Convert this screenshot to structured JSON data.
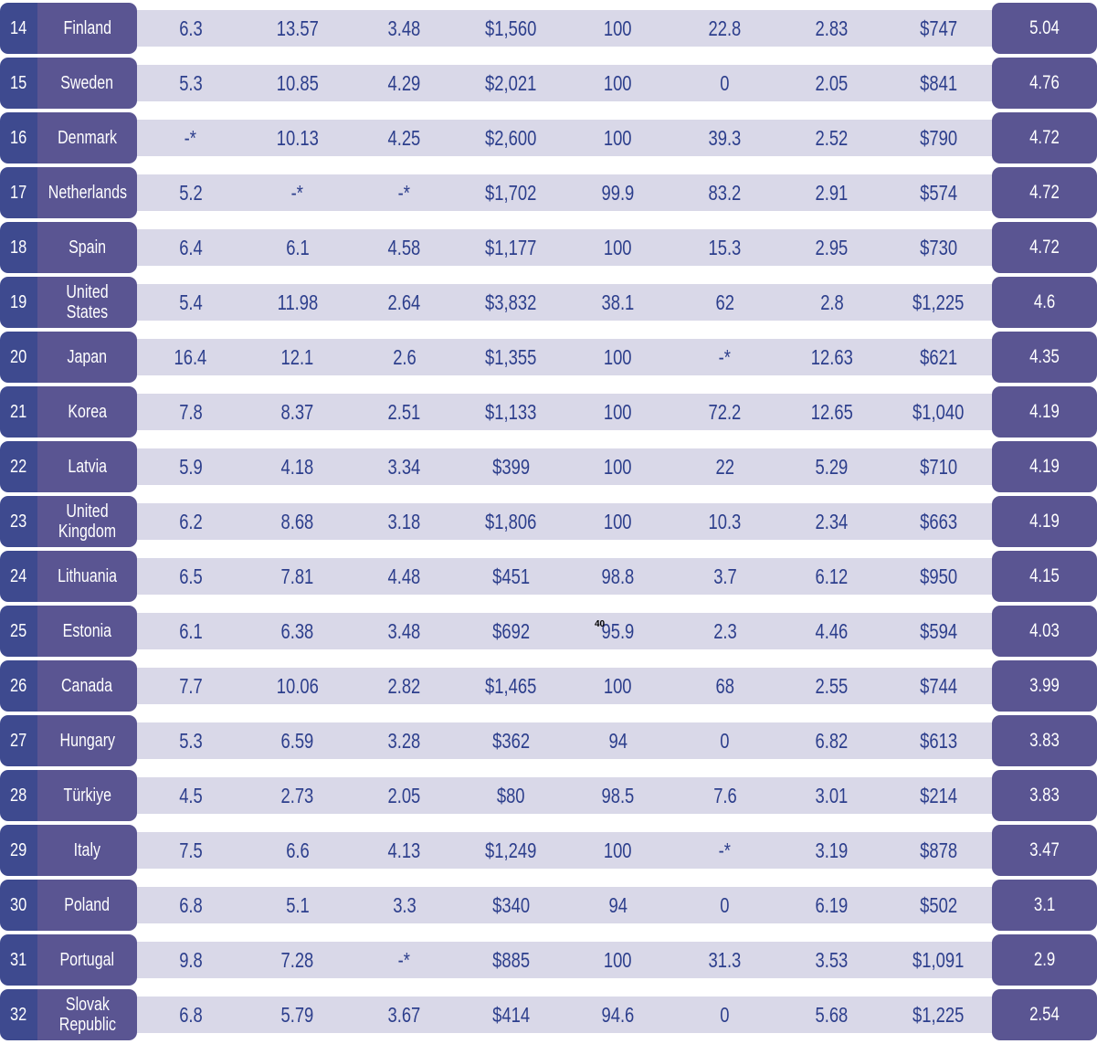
{
  "table": {
    "rows": [
      {
        "rank": "14",
        "country": "Finland",
        "values": [
          "6.3",
          "13.57",
          "3.48",
          "$1,560",
          "100",
          "22.8",
          "2.83",
          "$747"
        ],
        "score": "5.04"
      },
      {
        "rank": "15",
        "country": "Sweden",
        "values": [
          "5.3",
          "10.85",
          "4.29",
          "$2,021",
          "100",
          "0",
          "2.05",
          "$841"
        ],
        "score": "4.76"
      },
      {
        "rank": "16",
        "country": "Denmark",
        "values": [
          "-*",
          "10.13",
          "4.25",
          "$2,600",
          "100",
          "39.3",
          "2.52",
          "$790"
        ],
        "score": "4.72"
      },
      {
        "rank": "17",
        "country": "Netherlands",
        "values": [
          "5.2",
          "-*",
          "-*",
          "$1,702",
          "99.9",
          "83.2",
          "2.91",
          "$574"
        ],
        "score": "4.72"
      },
      {
        "rank": "18",
        "country": "Spain",
        "values": [
          "6.4",
          "6.1",
          "4.58",
          "$1,177",
          "100",
          "15.3",
          "2.95",
          "$730"
        ],
        "score": "4.72"
      },
      {
        "rank": "19",
        "country": "United States",
        "values": [
          "5.4",
          "11.98",
          "2.64",
          "$3,832",
          "38.1",
          "62",
          "2.8",
          "$1,225"
        ],
        "score": "4.6"
      },
      {
        "rank": "20",
        "country": "Japan",
        "values": [
          "16.4",
          "12.1",
          "2.6",
          "$1,355",
          "100",
          "-*",
          "12.63",
          "$621"
        ],
        "score": "4.35"
      },
      {
        "rank": "21",
        "country": "Korea",
        "values": [
          "7.8",
          "8.37",
          "2.51",
          "$1,133",
          "100",
          "72.2",
          "12.65",
          "$1,040"
        ],
        "score": "4.19"
      },
      {
        "rank": "22",
        "country": "Latvia",
        "values": [
          "5.9",
          "4.18",
          "3.34",
          "$399",
          "100",
          "22",
          "5.29",
          "$710"
        ],
        "score": "4.19"
      },
      {
        "rank": "23",
        "country": "United\nKingdom",
        "values": [
          "6.2",
          "8.68",
          "3.18",
          "$1,806",
          "100",
          "10.3",
          "2.34",
          "$663"
        ],
        "score": "4.19"
      },
      {
        "rank": "24",
        "country": "Lithuania",
        "values": [
          "6.5",
          "7.81",
          "4.48",
          "$451",
          "98.8",
          "3.7",
          "6.12",
          "$950"
        ],
        "score": "4.15"
      },
      {
        "rank": "25",
        "country": "Estonia",
        "values": [
          "6.1",
          "6.38",
          "3.48",
          "$692",
          "95.9",
          "2.3",
          "4.46",
          "$594"
        ],
        "score": "4.03"
      },
      {
        "rank": "26",
        "country": "Canada",
        "values": [
          "7.7",
          "10.06",
          "2.82",
          "$1,465",
          "100",
          "68",
          "2.55",
          "$744"
        ],
        "score": "3.99"
      },
      {
        "rank": "27",
        "country": "Hungary",
        "values": [
          "5.3",
          "6.59",
          "3.28",
          "$362",
          "94",
          "0",
          "6.82",
          "$613"
        ],
        "score": "3.83"
      },
      {
        "rank": "28",
        "country": "Türkiye",
        "values": [
          "4.5",
          "2.73",
          "2.05",
          "$80",
          "98.5",
          "7.6",
          "3.01",
          "$214"
        ],
        "score": "3.83"
      },
      {
        "rank": "29",
        "country": "Italy",
        "values": [
          "7.5",
          "6.6",
          "4.13",
          "$1,249",
          "100",
          "-*",
          "3.19",
          "$878"
        ],
        "score": "3.47"
      },
      {
        "rank": "30",
        "country": "Poland",
        "values": [
          "6.8",
          "5.1",
          "3.3",
          "$340",
          "94",
          "0",
          "6.19",
          "$502"
        ],
        "score": "3.1"
      },
      {
        "rank": "31",
        "country": "Portugal",
        "values": [
          "9.8",
          "7.28",
          "-*",
          "$885",
          "100",
          "31.3",
          "3.53",
          "$1,091"
        ],
        "score": "2.9"
      },
      {
        "rank": "32",
        "country": "Slovak\nRepublic",
        "values": [
          "6.8",
          "5.79",
          "3.67",
          "$414",
          "94.6",
          "0",
          "5.68",
          "$1,225"
        ],
        "score": "2.54"
      }
    ]
  },
  "page_number": "40",
  "colors": {
    "rank_bg": "#3e4a8f",
    "name_bg": "#5a5592",
    "stripe_bg": "#d9d8e8",
    "value_text": "#2c3e8c"
  }
}
